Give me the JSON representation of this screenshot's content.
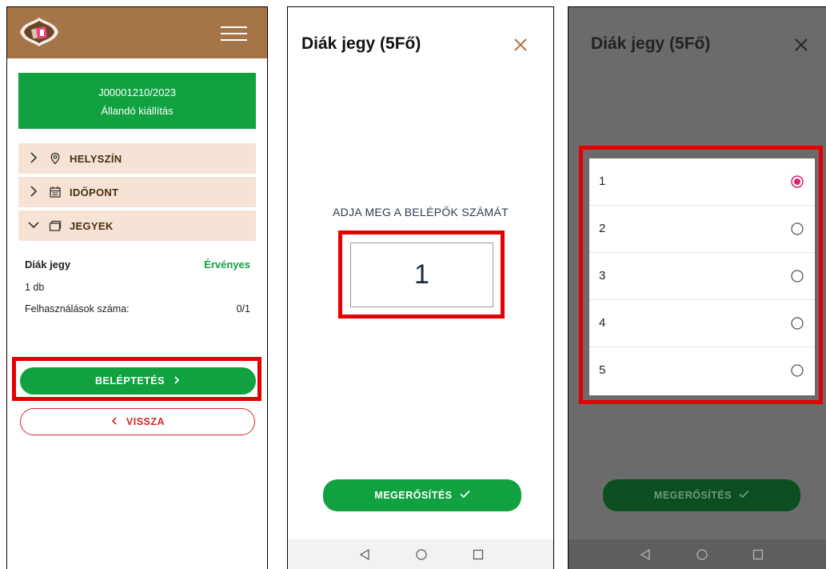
{
  "screen1": {
    "ticket_code": "J00001210/2023",
    "exhibition": "Állandó kiállítás",
    "sections": [
      {
        "label": "HELYSZÍN",
        "icon": "location-pin-icon",
        "expanded": false
      },
      {
        "label": "IDŐPONT",
        "icon": "calendar-icon",
        "expanded": false
      },
      {
        "label": "JEGYEK",
        "icon": "ticket-icon",
        "expanded": true
      }
    ],
    "ticket": {
      "name": "Diák jegy",
      "status": "Érvényes",
      "quantity": "1 db",
      "usage_label": "Felhasználások száma:",
      "usage_value": "0/1"
    },
    "enter_button": "BELÉPTETÉS",
    "back_button": "VISSZA"
  },
  "screen2": {
    "title": "Diák jegy (5Fő)",
    "prompt": "ADJA MEG A BELÉPŐK SZÁMÁT",
    "quantity": "1",
    "confirm_button": "MEGERŐSÍTÉS"
  },
  "screen3": {
    "title": "Diák jegy (5Fő)",
    "options": [
      "1",
      "2",
      "3",
      "4",
      "5"
    ],
    "selected": "1",
    "confirm_button": "MEGERŐSÍTÉS"
  },
  "colors": {
    "brand_brown": "#a57447",
    "primary_green": "#11a140",
    "accordion_bg": "#f7e3d5",
    "danger_red": "#d7262d",
    "highlight_red": "#e50000",
    "radio_selected": "#d3286b",
    "close_x": "#b5794a"
  }
}
